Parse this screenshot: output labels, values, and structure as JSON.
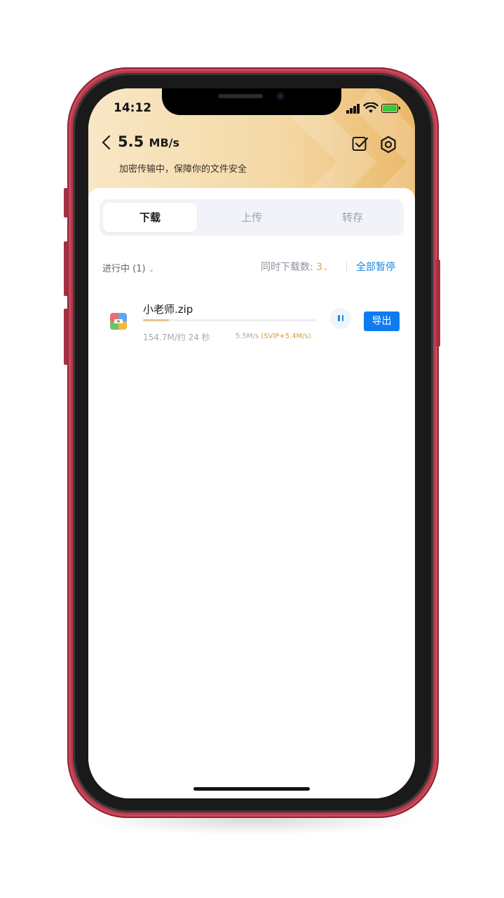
{
  "status_bar": {
    "time": "14:12"
  },
  "header": {
    "speed_value": "5.5",
    "speed_unit": "MB/s",
    "subtitle": "加密传输中，保障你的文件安全"
  },
  "tabs": [
    {
      "label": "下载",
      "active": true
    },
    {
      "label": "上传",
      "active": false
    },
    {
      "label": "转存",
      "active": false
    }
  ],
  "filter": {
    "label": "进行中 (1)"
  },
  "concurrent": {
    "label": "同时下载数:",
    "value": "3"
  },
  "pause_all_label": "全部暂停",
  "downloads": [
    {
      "name": "小老师.zip",
      "progress": 0.15,
      "size_text": "154.7M/约 24 秒",
      "rate": "5.5M/s",
      "svip_rate": "(SVIP+5.4M/s)",
      "export_label": "导出"
    }
  ],
  "colors": {
    "accent_blue": "#0e7cf0",
    "gold": "#e3a635",
    "phone_frame": "#b8374b"
  }
}
